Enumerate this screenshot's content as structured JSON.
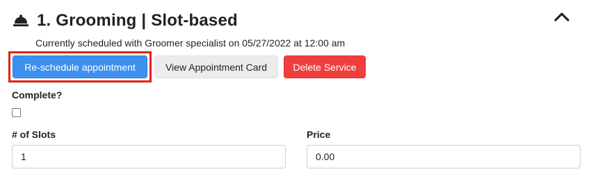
{
  "service": {
    "title": "1. Grooming | Slot-based",
    "header_icon": "bell-icon",
    "collapse_icon": "chevron-up-icon",
    "scheduled_text": "Currently scheduled with Groomer specialist on 05/27/2022 at 12:00 am"
  },
  "actions": {
    "reschedule_label": "Re-schedule appointment",
    "view_card_label": "View Appointment Card",
    "delete_label": "Delete Service"
  },
  "complete": {
    "label": "Complete?",
    "checked": false
  },
  "slots": {
    "label": "# of Slots",
    "value": "1"
  },
  "price": {
    "label": "Price",
    "value": "0.00"
  },
  "colors": {
    "primary": "#3d8ff0",
    "danger": "#f03e3e",
    "highlight": "#e3210e",
    "secondary": "#ececec"
  }
}
